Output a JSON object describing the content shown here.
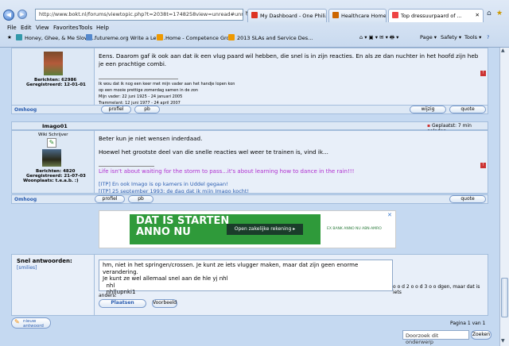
{
  "browser": {
    "address": "http://www.bokt.nl/forums/viewtopic.php?t=2038t=1748258view=unread#unres",
    "tabs": [
      {
        "label": "My Dashboard - One Phili..."
      },
      {
        "label": "Healthcare Home Page"
      },
      {
        "label": "Top dressuurpaard of ..."
      }
    ],
    "menu": [
      "File",
      "Edit",
      "View",
      "Favorites",
      "Tools",
      "Help"
    ],
    "bookmarks": [
      "Honey, Ghee, & Me Slow-...",
      "futureme.org Write a Lett...",
      "Home - Competence Gro...",
      "2013 SLAs and Service Des..."
    ],
    "tools": [
      "Page ▾",
      "Safety ▾",
      "Tools ▾",
      "?"
    ]
  },
  "post1": {
    "stats": "Berichten: 62986",
    "registered": "Geregistreerd: 12-01-01",
    "body": "Eens. Daarom gaf ik ook aan dat ik een vlug paard wil hebben, die snel is in zijn reacties. En als ze dan nuchter in het hoofd zijn heb je een prachtige combi.",
    "sig": [
      "Ik wou dat ik nog een keer met mijn vader aan het handje lopen kon",
      "op een mooie prettige zomerdag samen in de zon",
      "Mijn vader: 22 juni 1925 - 24 januari 2005",
      "Trammelant: 12 juni 1977 - 24 april 2007"
    ],
    "omhoog": "Omhoog",
    "profiel": "profiel",
    "pb": "pb",
    "wijzig": "wijzig",
    "quote": "quote"
  },
  "post2": {
    "author": "Imago01",
    "rank": "Wiki Schrijver",
    "stats": "Berichten: 4820",
    "registered": "Geregistreerd: 21-07-03",
    "location": "Woonplaats: t.e.a.b. :)",
    "posted": "Geplaatst: 7 min geleden",
    "line1": "Beter kun je niet wensen inderdaad.",
    "line2": "Hoewel het grootste deel van die snelle reacties wel weer te trainen is, vind ik...",
    "quote_purple": "Life isn't about waiting for the storm to pass...it's about learning how to dance in the rain!!!",
    "itp1": "[ITP] En ook Imago is op kamers in Uddel gegaan!",
    "itp2": "[ITP] 25 september 1993: de dag dat ik mijn Imago kocht!",
    "omhoog": "Omhoog",
    "profiel": "profiel",
    "pb": "pb",
    "quote": "quote"
  },
  "ad": {
    "headline1": "DAT IS STARTEN",
    "headline2": "ANNO NU",
    "cta": "Open zakelijke rekening ▸",
    "brand": "EX BANK ANNO NU  ABN·AMRO"
  },
  "reply": {
    "label": "Snel antwoorden:",
    "smilies": "[smilies]",
    "text": [
      "hm, niet in het springen/crossen. Je kunt ze iets vlugger maken, maar dat zijn geen enorme verandering.",
      "Je kunt ze wel allemaal snel aan de hle yj nhl",
      "  nhl",
      "  nhl|upnki1"
    ],
    "overflow1": "o o d 2 o o d 3 o o dgen, maar dat is iets",
    "overflow2": "anders.",
    "plaatsen": "Plaatsen",
    "voorbeeld": "Voorbeeld"
  },
  "footer": {
    "new_reply": "nieuw antwoord",
    "pagina": "Pagina 1 van 1",
    "search_placeholder": "Doorzoek dit onderwerp",
    "search_button": "Zoeken"
  },
  "colors": {
    "accent": "#2a5db0",
    "ad_green": "#2f9a3a",
    "ad_dark": "#1a3d2a"
  }
}
